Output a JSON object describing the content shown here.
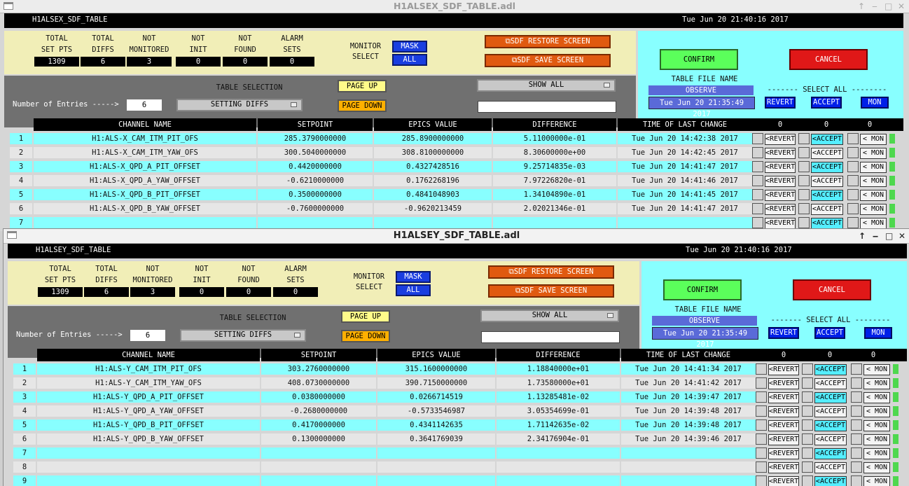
{
  "windows": [
    {
      "title": "H1ALSEX_SDF_TABLE.adl",
      "header": {
        "name": "H1ALSEX_SDF_TABLE",
        "datetime": "Tue Jun 20 21:40:16 2017"
      },
      "stats": [
        {
          "label1": "TOTAL",
          "label2": "SET PTS",
          "value": "1309"
        },
        {
          "label1": "TOTAL",
          "label2": "DIFFS",
          "value": "6"
        },
        {
          "label1": "NOT",
          "label2": "MONITORED",
          "value": "3"
        },
        {
          "label1": "NOT",
          "label2": "INIT",
          "value": "0"
        },
        {
          "label1": "NOT",
          "label2": "FOUND",
          "value": "0"
        },
        {
          "label1": "ALARM",
          "label2": "SETS",
          "value": "0"
        }
      ],
      "monitor_select": {
        "label1": "MONITOR",
        "label2": "SELECT",
        "mask": "MASK",
        "all": "ALL"
      },
      "restore_label": "SDF RESTORE SCREEN",
      "save_label": "SDF SAVE SCREEN",
      "confirm_label": "CONFIRM",
      "cancel_label": "CANCEL",
      "table_file_label": "TABLE FILE NAME",
      "table_file_value": "OBSERVE",
      "table_file_date": "Tue Jun 20 21:35:49 2017",
      "select_all_label": "------- SELECT ALL --------",
      "select_all_buttons": {
        "revert": "REVERT",
        "accept": "ACCEPT",
        "mon": "MON"
      },
      "table_selection_label": "TABLE SELECTION",
      "table_selection_value": "SETTING DIFFS",
      "page_up": "PAGE UP",
      "page_down": "PAGE DOWN",
      "show_all": "SHOW ALL",
      "entries_label": "Number of Entries ----->",
      "entries_value": "6",
      "columns": {
        "channel": "CHANNEL NAME",
        "setpoint": "SETPOINT",
        "epics": "EPICS VALUE",
        "difference": "DIFFERENCE",
        "time": "TIME OF LAST CHANGE",
        "c1": "0",
        "c2": "0",
        "c3": "0"
      },
      "row_buttons": {
        "revert": "<REVERT",
        "accept": "<ACCEPT",
        "mon": "< MON"
      },
      "rows": [
        {
          "n": "1",
          "channel": "H1:ALS-X_CAM_ITM_PIT_OFS",
          "setpoint": "285.3790000000",
          "epics": "285.8900000000",
          "difference": "5.11000000e-01",
          "time": "Tue Jun 20 14:42:38 2017"
        },
        {
          "n": "2",
          "channel": "H1:ALS-X_CAM_ITM_YAW_OFS",
          "setpoint": "300.5040000000",
          "epics": "308.8100000000",
          "difference": "8.30600000e+00",
          "time": "Tue Jun 20 14:42:45 2017"
        },
        {
          "n": "3",
          "channel": "H1:ALS-X_QPD_A_PIT_OFFSET",
          "setpoint": "0.4420000000",
          "epics": "0.4327428516",
          "difference": "9.25714835e-03",
          "time": "Tue Jun 20 14:41:47 2017"
        },
        {
          "n": "4",
          "channel": "H1:ALS-X_QPD_A_YAW_OFFSET",
          "setpoint": "-0.6210000000",
          "epics": "0.1762268196",
          "difference": "7.97226820e-01",
          "time": "Tue Jun 20 14:41:46 2017"
        },
        {
          "n": "5",
          "channel": "H1:ALS-X_QPD_B_PIT_OFFSET",
          "setpoint": "0.3500000000",
          "epics": "0.4841048903",
          "difference": "1.34104890e-01",
          "time": "Tue Jun 20 14:41:45 2017"
        },
        {
          "n": "6",
          "channel": "H1:ALS-X_QPD_B_YAW_OFFSET",
          "setpoint": "-0.7600000000",
          "epics": "-0.9620213459",
          "difference": "2.02021346e-01",
          "time": "Tue Jun 20 14:41:47 2017"
        },
        {
          "n": "7",
          "channel": "",
          "setpoint": "",
          "epics": "",
          "difference": "",
          "time": ""
        }
      ]
    },
    {
      "title": "H1ALSEY_SDF_TABLE.adl",
      "header": {
        "name": "H1ALSEY_SDF_TABLE",
        "datetime": "Tue Jun 20 21:40:16 2017"
      },
      "stats": [
        {
          "label1": "TOTAL",
          "label2": "SET PTS",
          "value": "1309"
        },
        {
          "label1": "TOTAL",
          "label2": "DIFFS",
          "value": "6"
        },
        {
          "label1": "NOT",
          "label2": "MONITORED",
          "value": "3"
        },
        {
          "label1": "NOT",
          "label2": "INIT",
          "value": "0"
        },
        {
          "label1": "NOT",
          "label2": "FOUND",
          "value": "0"
        },
        {
          "label1": "ALARM",
          "label2": "SETS",
          "value": "0"
        }
      ],
      "monitor_select": {
        "label1": "MONITOR",
        "label2": "SELECT",
        "mask": "MASK",
        "all": "ALL"
      },
      "restore_label": "SDF RESTORE SCREEN",
      "save_label": "SDF SAVE SCREEN",
      "confirm_label": "CONFIRM",
      "cancel_label": "CANCEL",
      "table_file_label": "TABLE FILE NAME",
      "table_file_value": "OBSERVE",
      "table_file_date": "Tue Jun 20 21:35:49 2017",
      "select_all_label": "------- SELECT ALL --------",
      "select_all_buttons": {
        "revert": "REVERT",
        "accept": "ACCEPT",
        "mon": "MON"
      },
      "table_selection_label": "TABLE SELECTION",
      "table_selection_value": "SETTING DIFFS",
      "page_up": "PAGE UP",
      "page_down": "PAGE DOWN",
      "show_all": "SHOW ALL",
      "entries_label": "Number of Entries ----->",
      "entries_value": "6",
      "columns": {
        "channel": "CHANNEL NAME",
        "setpoint": "SETPOINT",
        "epics": "EPICS VALUE",
        "difference": "DIFFERENCE",
        "time": "TIME OF LAST CHANGE",
        "c1": "0",
        "c2": "0",
        "c3": "0"
      },
      "row_buttons": {
        "revert": "<REVERT",
        "accept": "<ACCEPT",
        "mon": "< MON"
      },
      "rows": [
        {
          "n": "1",
          "channel": "H1:ALS-Y_CAM_ITM_PIT_OFS",
          "setpoint": "303.2760000000",
          "epics": "315.1600000000",
          "difference": "1.18840000e+01",
          "time": "Tue Jun 20 14:41:34 2017"
        },
        {
          "n": "2",
          "channel": "H1:ALS-Y_CAM_ITM_YAW_OFS",
          "setpoint": "408.0730000000",
          "epics": "390.7150000000",
          "difference": "1.73580000e+01",
          "time": "Tue Jun 20 14:41:42 2017"
        },
        {
          "n": "3",
          "channel": "H1:ALS-Y_QPD_A_PIT_OFFSET",
          "setpoint": "0.0380000000",
          "epics": "0.0266714519",
          "difference": "1.13285481e-02",
          "time": "Tue Jun 20 14:39:47 2017"
        },
        {
          "n": "4",
          "channel": "H1:ALS-Y_QPD_A_YAW_OFFSET",
          "setpoint": "-0.2680000000",
          "epics": "-0.5733546987",
          "difference": "3.05354699e-01",
          "time": "Tue Jun 20 14:39:48 2017"
        },
        {
          "n": "5",
          "channel": "H1:ALS-Y_QPD_B_PIT_OFFSET",
          "setpoint": "0.4170000000",
          "epics": "0.4341142635",
          "difference": "1.71142635e-02",
          "time": "Tue Jun 20 14:39:48 2017"
        },
        {
          "n": "6",
          "channel": "H1:ALS-Y_QPD_B_YAW_OFFSET",
          "setpoint": "0.1300000000",
          "epics": "0.3641769039",
          "difference": "2.34176904e-01",
          "time": "Tue Jun 20 14:39:46 2017"
        },
        {
          "n": "7",
          "channel": "",
          "setpoint": "",
          "epics": "",
          "difference": "",
          "time": ""
        },
        {
          "n": "8",
          "channel": "",
          "setpoint": "",
          "epics": "",
          "difference": "",
          "time": ""
        },
        {
          "n": "9",
          "channel": "",
          "setpoint": "",
          "epics": "",
          "difference": "",
          "time": ""
        }
      ]
    }
  ],
  "colors": {
    "cyan": "#88ffff",
    "yellow_panel": "#f1eeb7",
    "gray_panel": "#707070",
    "confirm": "#5bff5b",
    "cancel": "#e01818"
  },
  "icons": {
    "window_menu": "window-menu-icon",
    "maximize": "up-arrow-icon",
    "minimize": "minimize-icon",
    "restore": "maximize-icon",
    "close": "close-icon",
    "dropdown": "dropdown-arrow-icon"
  }
}
